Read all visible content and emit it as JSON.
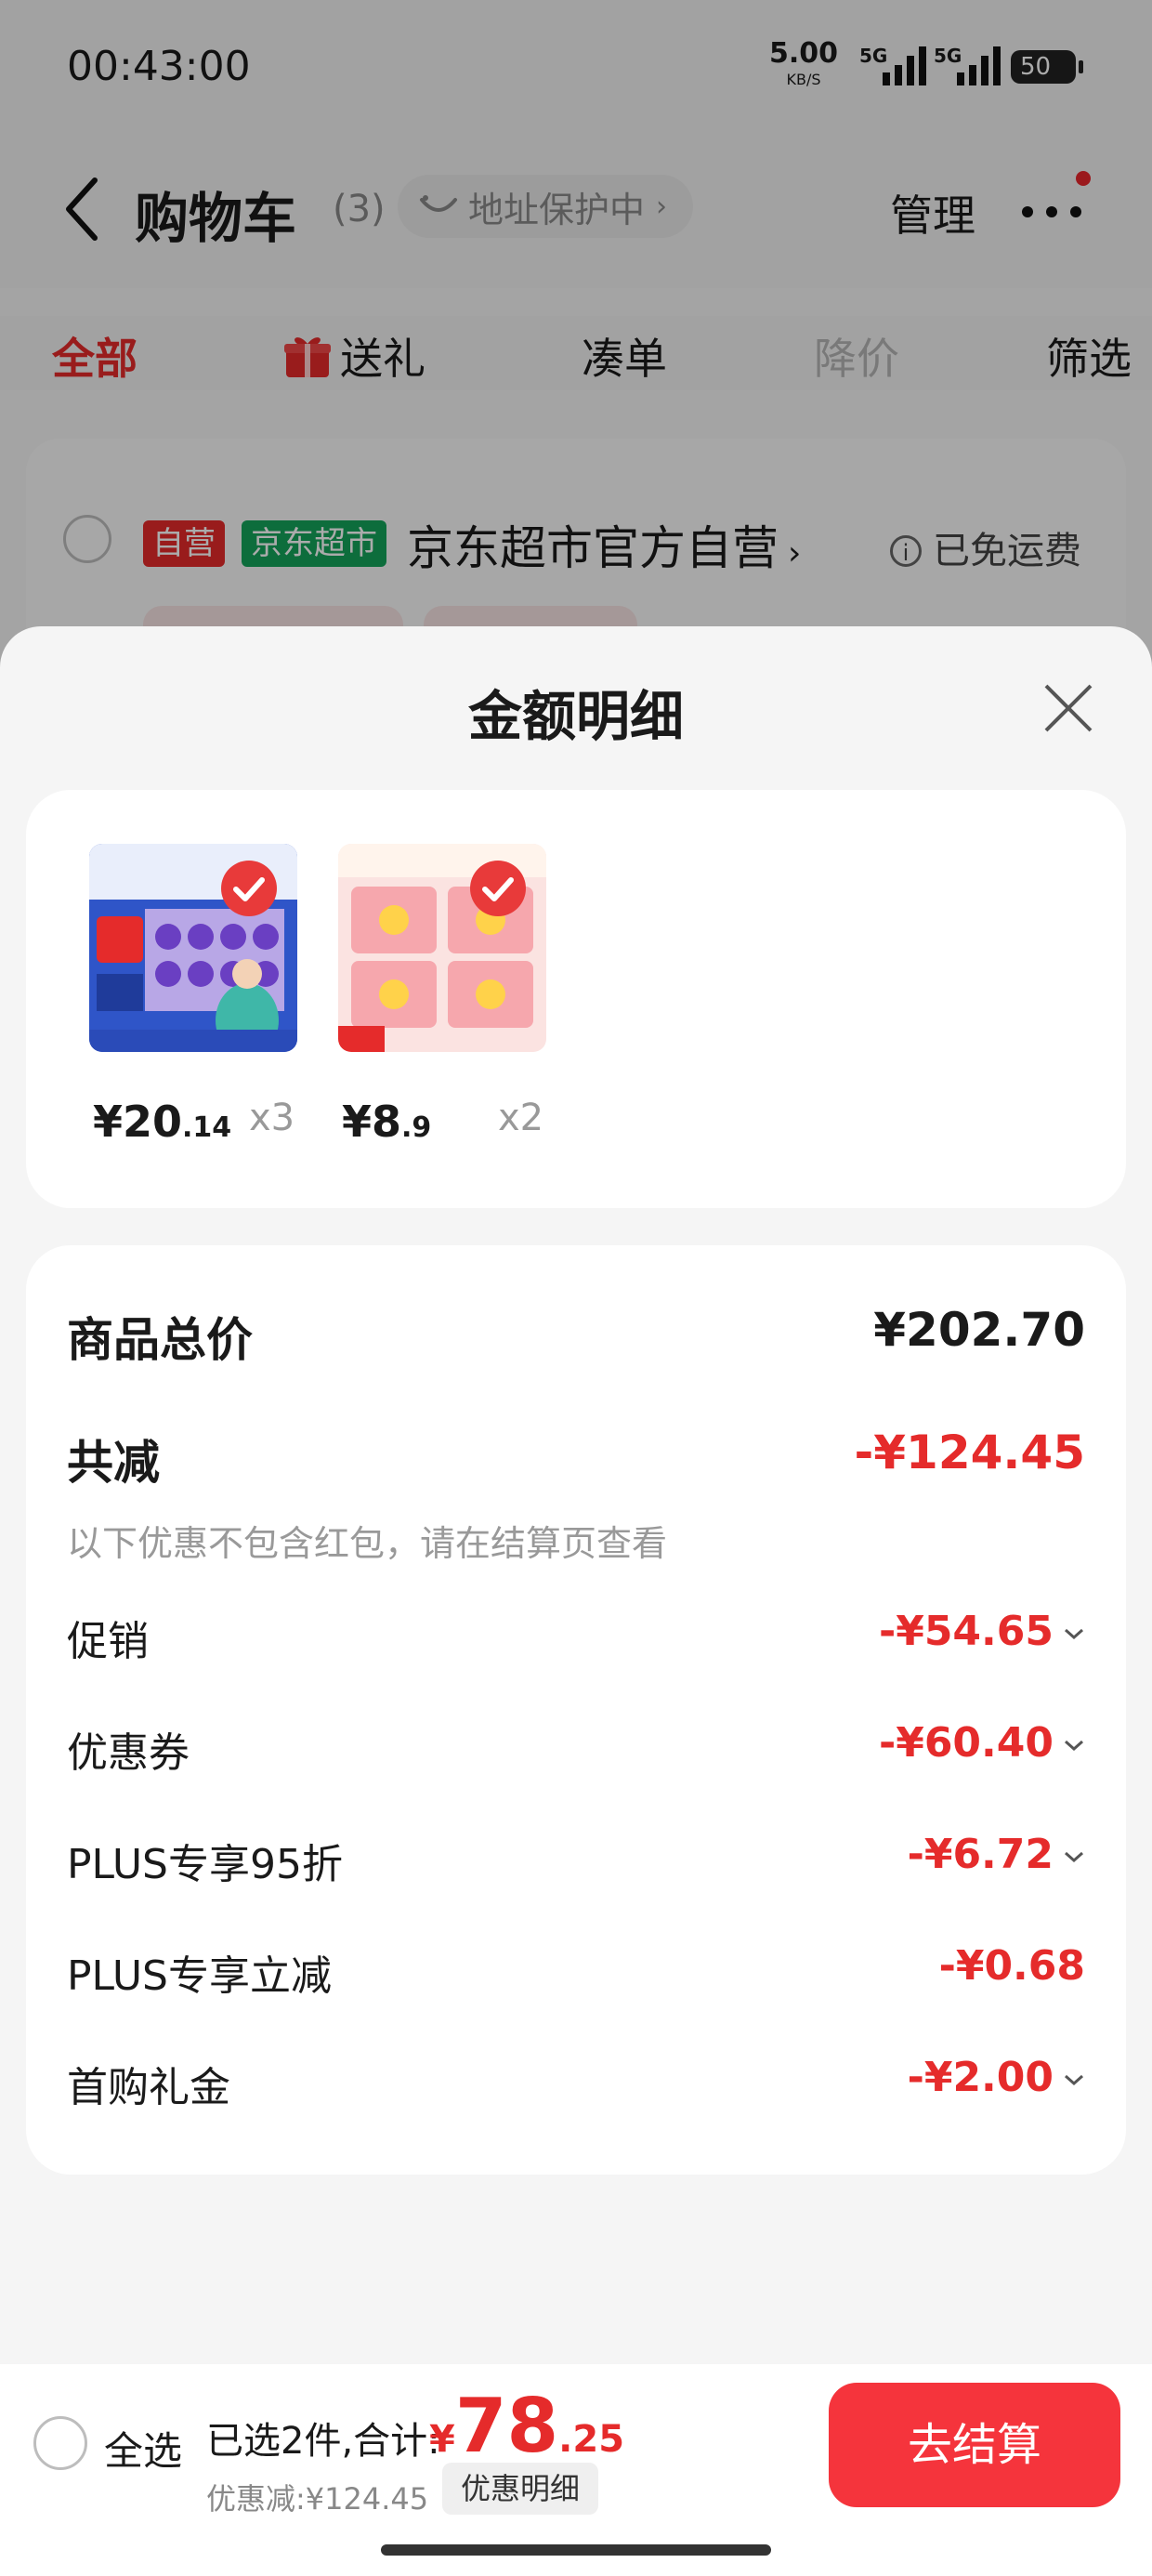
{
  "status_bar": {
    "time": "00:43:00",
    "net_speed": "5.00",
    "net_unit": "KB/S",
    "signal1": "5G",
    "signal2": "5G",
    "battery": "50"
  },
  "header": {
    "title": "购物车",
    "count": "(3)",
    "address_protection": "地址保护中",
    "manage": "管理"
  },
  "filter_tabs": [
    {
      "label": "全部",
      "state": "active"
    },
    {
      "label": "送礼",
      "icon": "gift-icon"
    },
    {
      "label": "凑单"
    },
    {
      "label": "降价",
      "state": "disabled"
    },
    {
      "label": "筛选"
    }
  ],
  "store": {
    "tag_self": "自营",
    "tag_market": "京东超市",
    "name": "京东超市官方自营",
    "chevron": "›",
    "shipping": "已免运费"
  },
  "sheet": {
    "title": "金额明细",
    "items": [
      {
        "price_int": "¥20",
        "price_dec": ".14",
        "qty": "x3"
      },
      {
        "price_int": "¥8",
        "price_dec": ".9",
        "qty": "x2"
      }
    ],
    "total_label": "商品总价",
    "total_value": "¥202.70",
    "reduce_label": "共减",
    "reduce_value": "-¥124.45",
    "reduce_note": "以下优惠不包含红包，请在结算页查看",
    "discounts": [
      {
        "label": "促销",
        "value": "-¥54.65",
        "expandable": true
      },
      {
        "label": "优惠券",
        "value": "-¥60.40",
        "expandable": true
      },
      {
        "label": "PLUS专享95折",
        "value": "-¥6.72",
        "expandable": true
      },
      {
        "label": "PLUS专享立减",
        "value": "-¥0.68",
        "expandable": false
      },
      {
        "label": "首购礼金",
        "value": "-¥2.00",
        "expandable": true
      }
    ]
  },
  "bottom_bar": {
    "select_all": "全选",
    "selected_text": "已选2件,合计:",
    "total_currency": "¥",
    "total_int": "78",
    "total_dec": ".25",
    "discount_text": "优惠减:¥124.45",
    "detail_link": "优惠明细",
    "checkout": "去结算"
  },
  "colors": {
    "accent_red": "#e52b2b",
    "checkout_red": "#f5343c",
    "green_tag": "#14a35a"
  }
}
